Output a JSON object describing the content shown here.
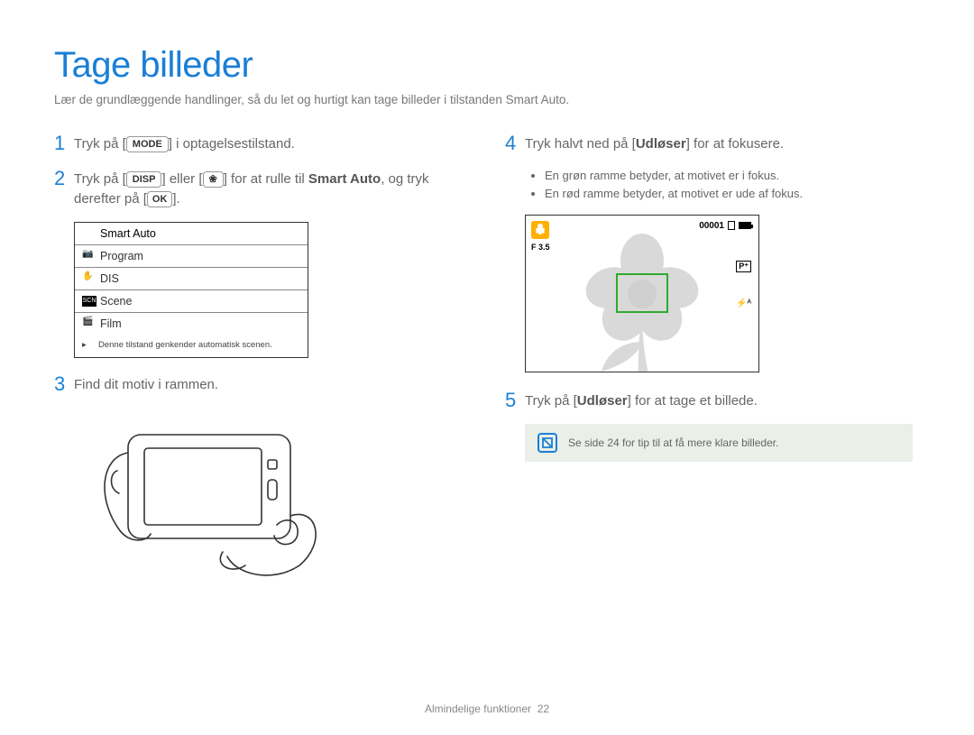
{
  "title": "Tage billeder",
  "subtitle": "Lær de grundlæggende handlinger, så du let og hurtigt kan tage billeder i tilstanden Smart Auto.",
  "buttons": {
    "mode": "MODE",
    "disp": "DISP",
    "macro": "❀",
    "ok": "OK"
  },
  "steps": {
    "s1": {
      "num": "1",
      "pre": "Tryk på [",
      "post": "] i optagelsestilstand."
    },
    "s2": {
      "num": "2",
      "pre": "Tryk på [",
      "mid1": "] eller [",
      "mid2": "] for at rulle til ",
      "smart": "Smart Auto",
      "mid3": ", og tryk derefter på [",
      "post": "]."
    },
    "s3": {
      "num": "3",
      "text": "Find dit motiv i rammen."
    },
    "s4": {
      "num": "4",
      "pre": "Tryk halvt ned på [",
      "bold": "Udløser",
      "post": "] for at fokusere."
    },
    "s5": {
      "num": "5",
      "pre": "Tryk på [",
      "bold": "Udløser",
      "post": "] for at tage et billede."
    }
  },
  "bullets": {
    "b1": "En grøn ramme betyder, at motivet er i fokus.",
    "b2": "En rød ramme betyder, at motivet er ude af fokus."
  },
  "menu": {
    "items": [
      "Smart Auto",
      "Program",
      "DIS",
      "Scene",
      "Film"
    ],
    "footer": "Denne tilstand genkender automatisk scenen."
  },
  "screen": {
    "counter": "00001",
    "f": "F 3.5",
    "badge": "P⁺",
    "flash": "⚡ᴬ"
  },
  "tip": "Se side 24 for tip til at få mere klare billeder.",
  "footer": {
    "label": "Almindelige funktioner",
    "page": "22"
  }
}
